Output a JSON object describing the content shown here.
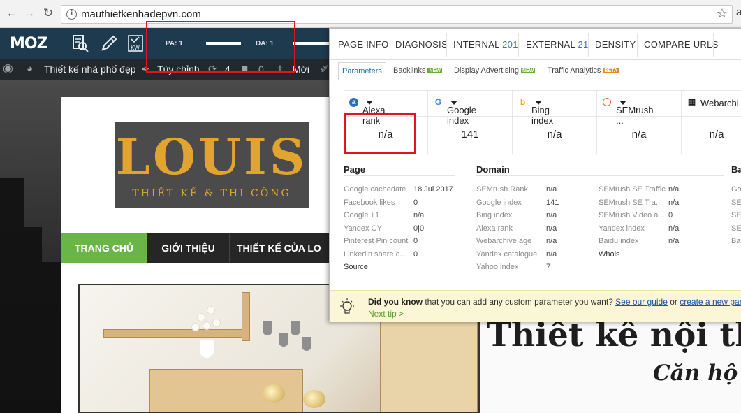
{
  "browser": {
    "url": "mauthietkenhadepvn.com",
    "back_icon": "arrow-left-icon",
    "forward_icon": "arrow-right-icon",
    "reload_icon": "reload-icon",
    "edge_char": "a"
  },
  "moz_toolbar": {
    "logo": "MOZ",
    "pa_label": "PA: 1",
    "da_label": "DA: 1"
  },
  "wp_admin": {
    "site_name": "Thiết kế nhà phố đẹp",
    "customize": "Tùy chỉnh",
    "updates_count": "4",
    "comments_count": "0",
    "new_label": "Mới"
  },
  "site": {
    "logo_text": "LOUIS",
    "logo_sub": "THIẾT KẾ & THI CÔNG",
    "nav": [
      "TRANG CHỦ",
      "GIỚI THIỆU",
      "THIẾT KẾ CỦA LO"
    ],
    "headline": "Thiết kê nội thâ",
    "headline2": "Căn hộ"
  },
  "panel": {
    "tabs": [
      {
        "label": "PAGE INFO",
        "count": ""
      },
      {
        "label": "DIAGNOSIS",
        "count": ""
      },
      {
        "label": "INTERNAL",
        "count": "201"
      },
      {
        "label": "EXTERNAL",
        "count": "21"
      },
      {
        "label": "DENSITY",
        "count": ""
      },
      {
        "label": "COMPARE URLS",
        "count": ""
      }
    ],
    "subtabs": [
      {
        "label": "Parameters",
        "badge": ""
      },
      {
        "label": "Backlinks",
        "badge": "NEW"
      },
      {
        "label": "Display Advertising",
        "badge": "NEW"
      },
      {
        "label": "Traffic Analytics",
        "badge": "BETA"
      }
    ],
    "metrics": [
      {
        "name": "Alexa rank",
        "value": "n/a",
        "icon": "alexa-icon"
      },
      {
        "name": "Google index",
        "value": "141",
        "icon": "google-icon"
      },
      {
        "name": "Bing index",
        "value": "n/a",
        "icon": "bing-icon"
      },
      {
        "name": "SEMrush ...",
        "value": "n/a",
        "icon": "semrush-icon"
      },
      {
        "name": "Webarchi.",
        "value": "n/a",
        "icon": "webarchive-icon"
      }
    ],
    "page": {
      "title": "Page",
      "rows": [
        {
          "k": "Google cachedate",
          "v": "18 Jul 2017"
        },
        {
          "k": "Facebook likes",
          "v": "0"
        },
        {
          "k": "Google +1",
          "v": "n/a"
        },
        {
          "k": "Yandex CY",
          "v": "0|0"
        },
        {
          "k": "Pinterest Pin count",
          "v": "0"
        },
        {
          "k": "Linkedin share c...",
          "v": "0"
        },
        {
          "k": "Source",
          "v": ""
        }
      ]
    },
    "domain": {
      "title": "Domain",
      "left": [
        {
          "k": "SEMrush Rank",
          "v": "n/a"
        },
        {
          "k": "Google index",
          "v": "141"
        },
        {
          "k": "Bing index",
          "v": "n/a"
        },
        {
          "k": "Alexa rank",
          "v": "n/a"
        },
        {
          "k": "Webarchive age",
          "v": "n/a"
        },
        {
          "k": "Yandex catalogue",
          "v": "n/a"
        },
        {
          "k": "Yahoo index",
          "v": "7"
        }
      ],
      "right": [
        {
          "k": "SEMrush SE Traffic",
          "v": "n/a"
        },
        {
          "k": "SEMrush SE Tra...",
          "v": "n/a"
        },
        {
          "k": "SEMrush Video a...",
          "v": "0"
        },
        {
          "k": "Yandex index",
          "v": "n/a"
        },
        {
          "k": "Baidu index",
          "v": "n/a"
        },
        {
          "k": "Whois",
          "v": ""
        }
      ]
    },
    "third": {
      "title": "Ba",
      "rows": [
        "Goo",
        "SEI",
        "SEI",
        "SEI",
        "Bai"
      ]
    },
    "tip": {
      "bold": "Did you know",
      "text": " that you can add any custom parameter you want? ",
      "link1": "See our guide",
      "mid": " or ",
      "link2": "create a new parar",
      "next": "Next tip >"
    }
  }
}
